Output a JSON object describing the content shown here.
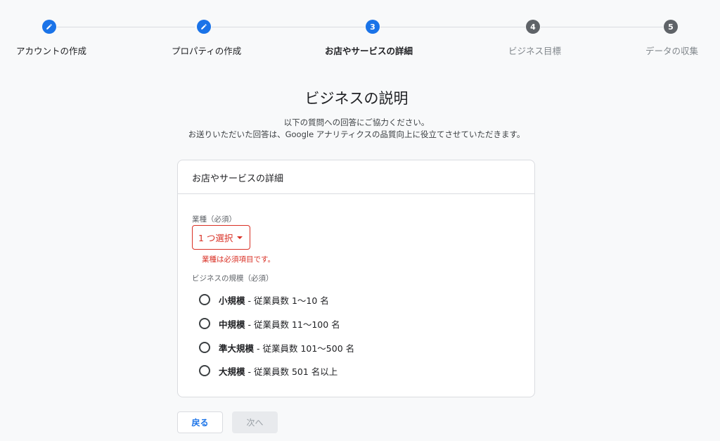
{
  "stepper": {
    "steps": [
      {
        "number": "",
        "label": "アカウントの作成",
        "state": "done"
      },
      {
        "number": "",
        "label": "プロパティの作成",
        "state": "done"
      },
      {
        "number": "3",
        "label": "お店やサービスの詳細",
        "state": "active"
      },
      {
        "number": "4",
        "label": "ビジネス目標",
        "state": "pending"
      },
      {
        "number": "5",
        "label": "データの収集",
        "state": "pending"
      }
    ]
  },
  "header": {
    "title": "ビジネスの説明",
    "subtitle_line1": "以下の質問への回答にご協力ください。",
    "subtitle_line2": "お送りいただいた回答は、Google アナリティクスの品質向上に役立てさせていただきます。"
  },
  "card": {
    "title": "お店やサービスの詳細",
    "industry": {
      "label": "業種（必須）",
      "select_value": "1 つ選択",
      "error": "業種は必須項目です。"
    },
    "size": {
      "label": "ビジネスの規模（必須）",
      "options": [
        {
          "bold": "小規模",
          "rest": " - 従業員数 1〜10 名"
        },
        {
          "bold": "中規模",
          "rest": " - 従業員数 11〜100 名"
        },
        {
          "bold": "準大規模",
          "rest": " - 従業員数 101〜500 名"
        },
        {
          "bold": "大規模",
          "rest": " - 従業員数 501 名以上"
        }
      ]
    }
  },
  "footer": {
    "back_label": "戻る",
    "next_label": "次へ"
  },
  "colors": {
    "accent": "#1a73e8",
    "error": "#d93025",
    "pending": "#5f6368"
  }
}
